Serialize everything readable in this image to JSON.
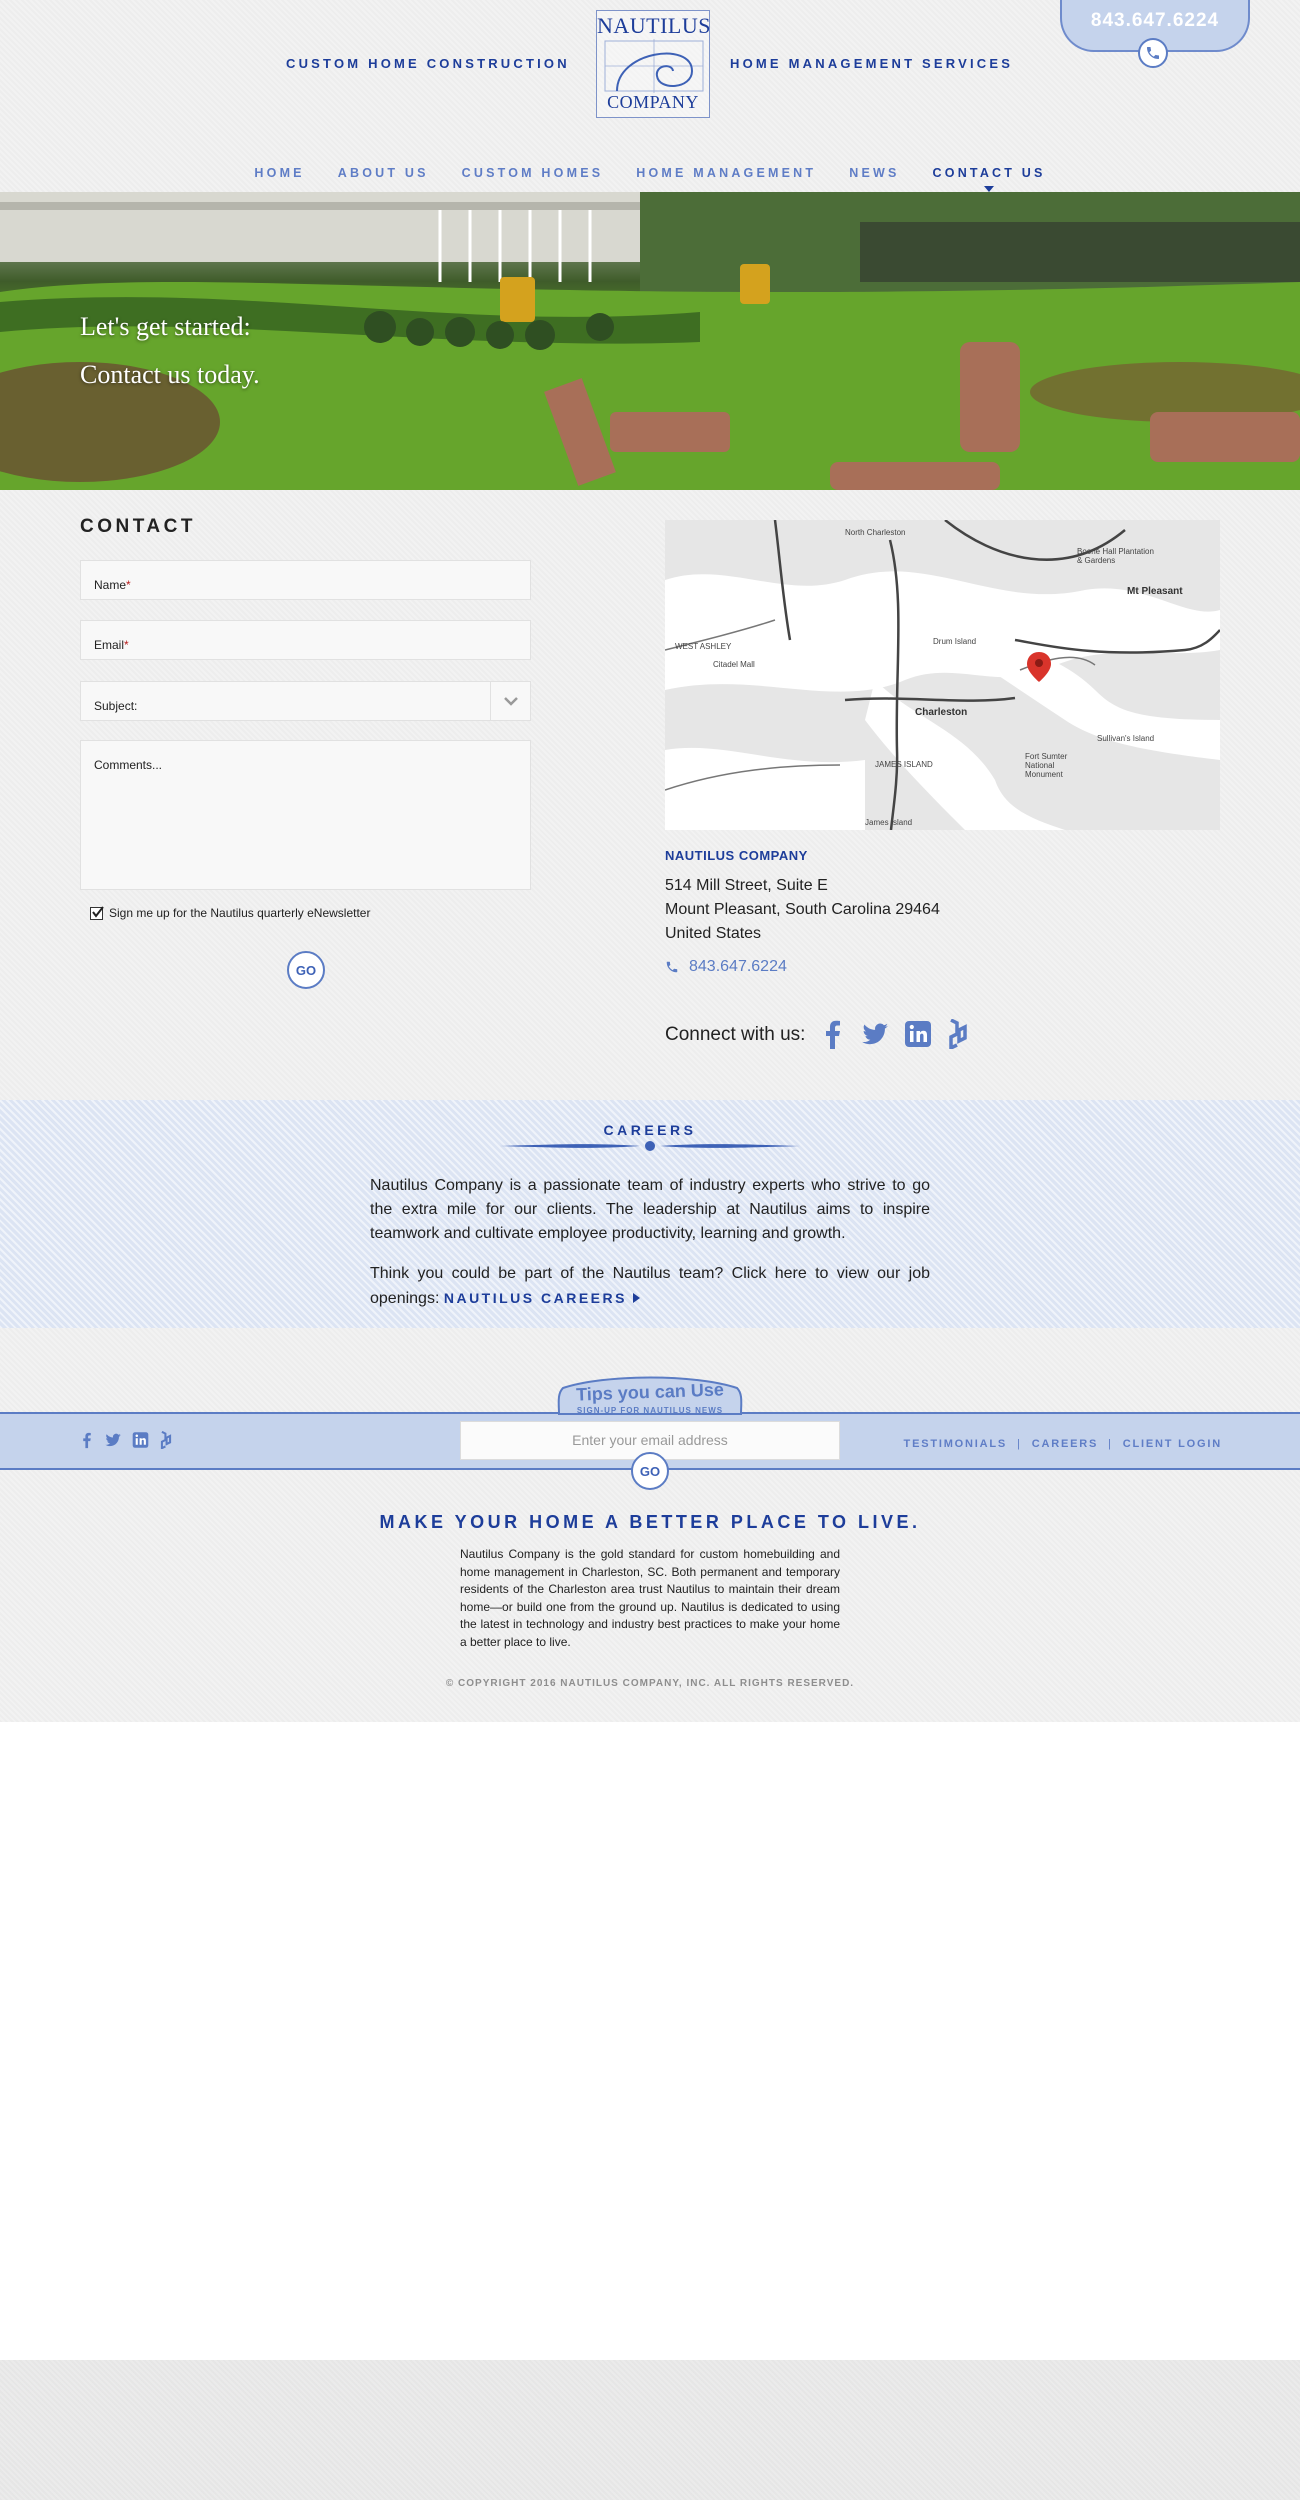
{
  "header": {
    "left_link": "CUSTOM HOME CONSTRUCTION",
    "right_link": "HOME MANAGEMENT SERVICES",
    "logo_top": "NAUTILUS",
    "logo_bottom": "COMPANY",
    "phone": "843.647.6224"
  },
  "nav": {
    "items": [
      "HOME",
      "ABOUT US",
      "CUSTOM HOMES",
      "HOME MANAGEMENT",
      "NEWS",
      "CONTACT US"
    ],
    "active": "CONTACT US"
  },
  "hero": {
    "line1": "Let's get started:",
    "line2": "Contact us today."
  },
  "contact": {
    "title": "CONTACT",
    "name_label": "Name",
    "email_label": "Email",
    "required_mark": "*",
    "subject_label": "Subject:",
    "comments_placeholder": "Comments...",
    "newsletter_label": "Sign me up for the Nautilus quarterly eNewsletter",
    "newsletter_checked": true,
    "submit_label": "GO"
  },
  "map": {
    "labels": [
      "North Charleston",
      "Boone Hall Plantation & Gardens",
      "Mt Pleasant",
      "Drum Island",
      "WEST ASHLEY",
      "Citadel Mall",
      "Charleston",
      "Fort Sumter National Monument",
      "Sullivan's Island",
      "JAMES ISLAND",
      "James Island"
    ]
  },
  "address": {
    "company": "NAUTILUS COMPANY",
    "line1": "514 Mill Street, Suite E",
    "line2": "Mount Pleasant, South Carolina 29464",
    "line3": "United States",
    "phone": "843.647.6224",
    "connect_label": "Connect with us:"
  },
  "careers": {
    "title": "CAREERS",
    "paragraph1": "Nautilus Company is a passionate team of industry experts who strive to go the extra mile for our clients. The leadership at Nautilus aims to inspire teamwork and cultivate employee productivity, learning and growth.",
    "paragraph2": "Think you could be part of the Nautilus team? Click here to view our job openings:",
    "link_label": "NAUTILUS CAREERS"
  },
  "footer": {
    "tips_title": "Tips you can Use",
    "tips_sub": "SIGN-UP FOR NAUTILUS NEWS",
    "email_placeholder": "Enter your email address",
    "submit_label": "GO",
    "links": [
      "TESTIMONIALS",
      "CAREERS",
      "CLIENT LOGIN"
    ],
    "tagline": "MAKE YOUR HOME A BETTER PLACE TO LIVE.",
    "about": "Nautilus Company is the gold standard for custom homebuilding and home management in Charleston, SC. Both permanent and temporary residents of the Charleston area trust Nautilus to maintain their dream home—or build one from the ground up. Nautilus is dedicated to using the latest in technology and industry best practices to make your home a better place to live.",
    "copyright": "© COPYRIGHT 2016 NAUTILUS COMPANY, INC. ALL RIGHTS RESERVED."
  },
  "icons": [
    "phone-icon",
    "chevron-down-icon",
    "check-icon",
    "map-pin-icon",
    "facebook-icon",
    "twitter-icon",
    "linkedin-icon",
    "houzz-icon",
    "caret-right-icon"
  ],
  "colors": {
    "brand_navy": "#1d3d9a",
    "brand_blue": "#5b7cc4",
    "light_blue": "#c5d3ec",
    "required": "#b51d1d"
  }
}
